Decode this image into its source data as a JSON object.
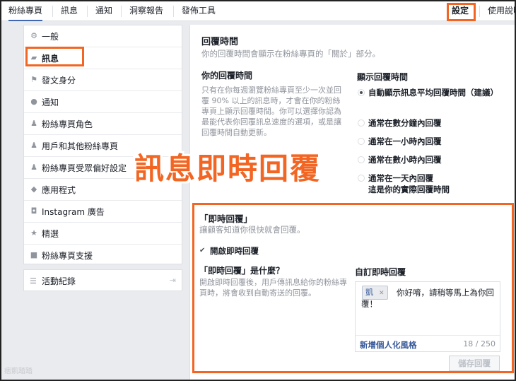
{
  "topnav": {
    "tabs": [
      {
        "label": "粉絲專頁"
      },
      {
        "label": "訊息"
      },
      {
        "label": "通知"
      },
      {
        "label": "洞察報告"
      },
      {
        "label": "發佈工具"
      }
    ],
    "settings": "設定",
    "help": "使用說明"
  },
  "sidebar": {
    "items": [
      {
        "label": "一般",
        "icon": "gear-icon"
      },
      {
        "label": "訊息",
        "icon": "message-icon"
      },
      {
        "label": "發文身分",
        "icon": "flag-icon"
      },
      {
        "label": "通知",
        "icon": "globe-icon"
      },
      {
        "label": "粉絲專頁角色",
        "icon": "person-icon"
      },
      {
        "label": "用戶和其他粉絲專頁",
        "icon": "people-icon"
      },
      {
        "label": "粉絲專頁受眾偏好設定",
        "icon": "audience-icon"
      },
      {
        "label": "應用程式",
        "icon": "cube-icon"
      },
      {
        "label": "Instagram 廣告",
        "icon": "camera-icon"
      },
      {
        "label": "精選",
        "icon": "star-icon"
      },
      {
        "label": "粉絲專頁支援",
        "icon": "facebook-icon"
      }
    ],
    "activity": "活動紀錄"
  },
  "response": {
    "title": "回覆時間",
    "subtitle": "你的回覆時間會顯示在粉絲專頁的「關於」部分。",
    "your_title": "你的回覆時間",
    "your_desc": "只有在你每週瀏覽粉絲專頁至少一次並回覆 90% 以上的訊息時，才會在你的粉絲專頁上顯示回覆時間。你可以選擇你認為最能代表你回覆訊息速度的選項，或是讓回覆時間自動更新。",
    "display_title": "顯示回覆時間",
    "options": [
      {
        "label": "自動顯示訊息平均回覆時間（建議）"
      },
      {
        "label": "通常在數分鐘內回覆"
      },
      {
        "label": "通常在一小時內回覆"
      },
      {
        "label": "通常在數小時內回覆"
      },
      {
        "label": "通常在一天內回覆"
      }
    ],
    "option_note": "這是你的實際回覆時間"
  },
  "overlay": "訊息即時回覆",
  "instant": {
    "title": "「即時回覆」",
    "subtitle": "讓顧客知道你很快就會回覆。",
    "enable_label": "開啟即時回覆",
    "what_title": "「即時回覆」是什麼？",
    "what_desc": "開啟即時回覆後，用戶傳訊息給你的粉絲專頁時，將會收到自動寄送的回覆。",
    "custom_title": "自訂即時回覆",
    "token": "凱",
    "reply_text": "你好唷，請稍等馬上為你回覆！",
    "personalize": "新增個人化風格",
    "count": "18 / 250",
    "save": "儲存回覆"
  },
  "watermark": "痞凱踏踏"
}
